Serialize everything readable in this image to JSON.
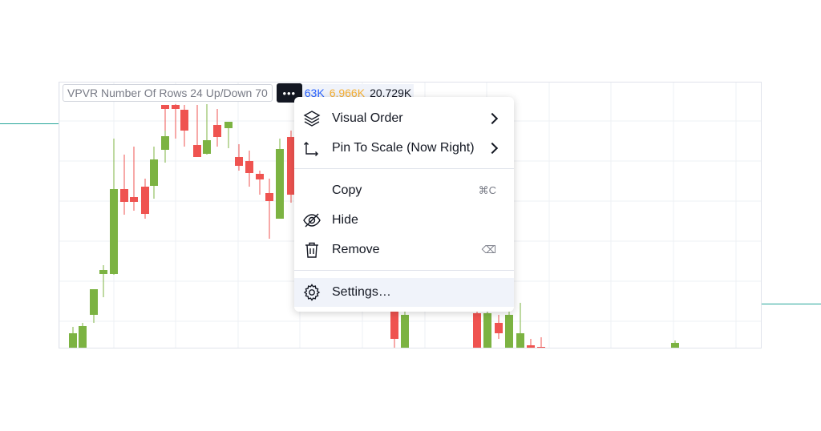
{
  "legend": {
    "indicator_label": "VPVR Number Of Rows 24 Up/Down 70",
    "more_icon": "more-horizontal-icon",
    "values": [
      {
        "text": "63K",
        "color": "#2962ff"
      },
      {
        "text": "6.966K",
        "color": "#f7b032"
      },
      {
        "text": "20.729K",
        "color": "#131722"
      }
    ]
  },
  "menu": {
    "items": [
      {
        "label": "Visual Order",
        "icon": "layers-icon",
        "submenu": true
      },
      {
        "label": "Pin To Scale (Now Right)",
        "icon": "pin-to-scale-icon",
        "submenu": true
      },
      {
        "label": "Copy",
        "shortcut": "⌘C"
      },
      {
        "label": "Hide",
        "icon": "eye-off-icon"
      },
      {
        "label": "Remove",
        "icon": "trash-icon",
        "shortcut": "⌫"
      },
      {
        "label": "Settings…",
        "icon": "gear-icon",
        "highlighted": true
      }
    ]
  },
  "colors": {
    "up": "#7cb342",
    "down": "#ef5350",
    "line": "#26a69a",
    "grid": "#eef0f4"
  }
}
